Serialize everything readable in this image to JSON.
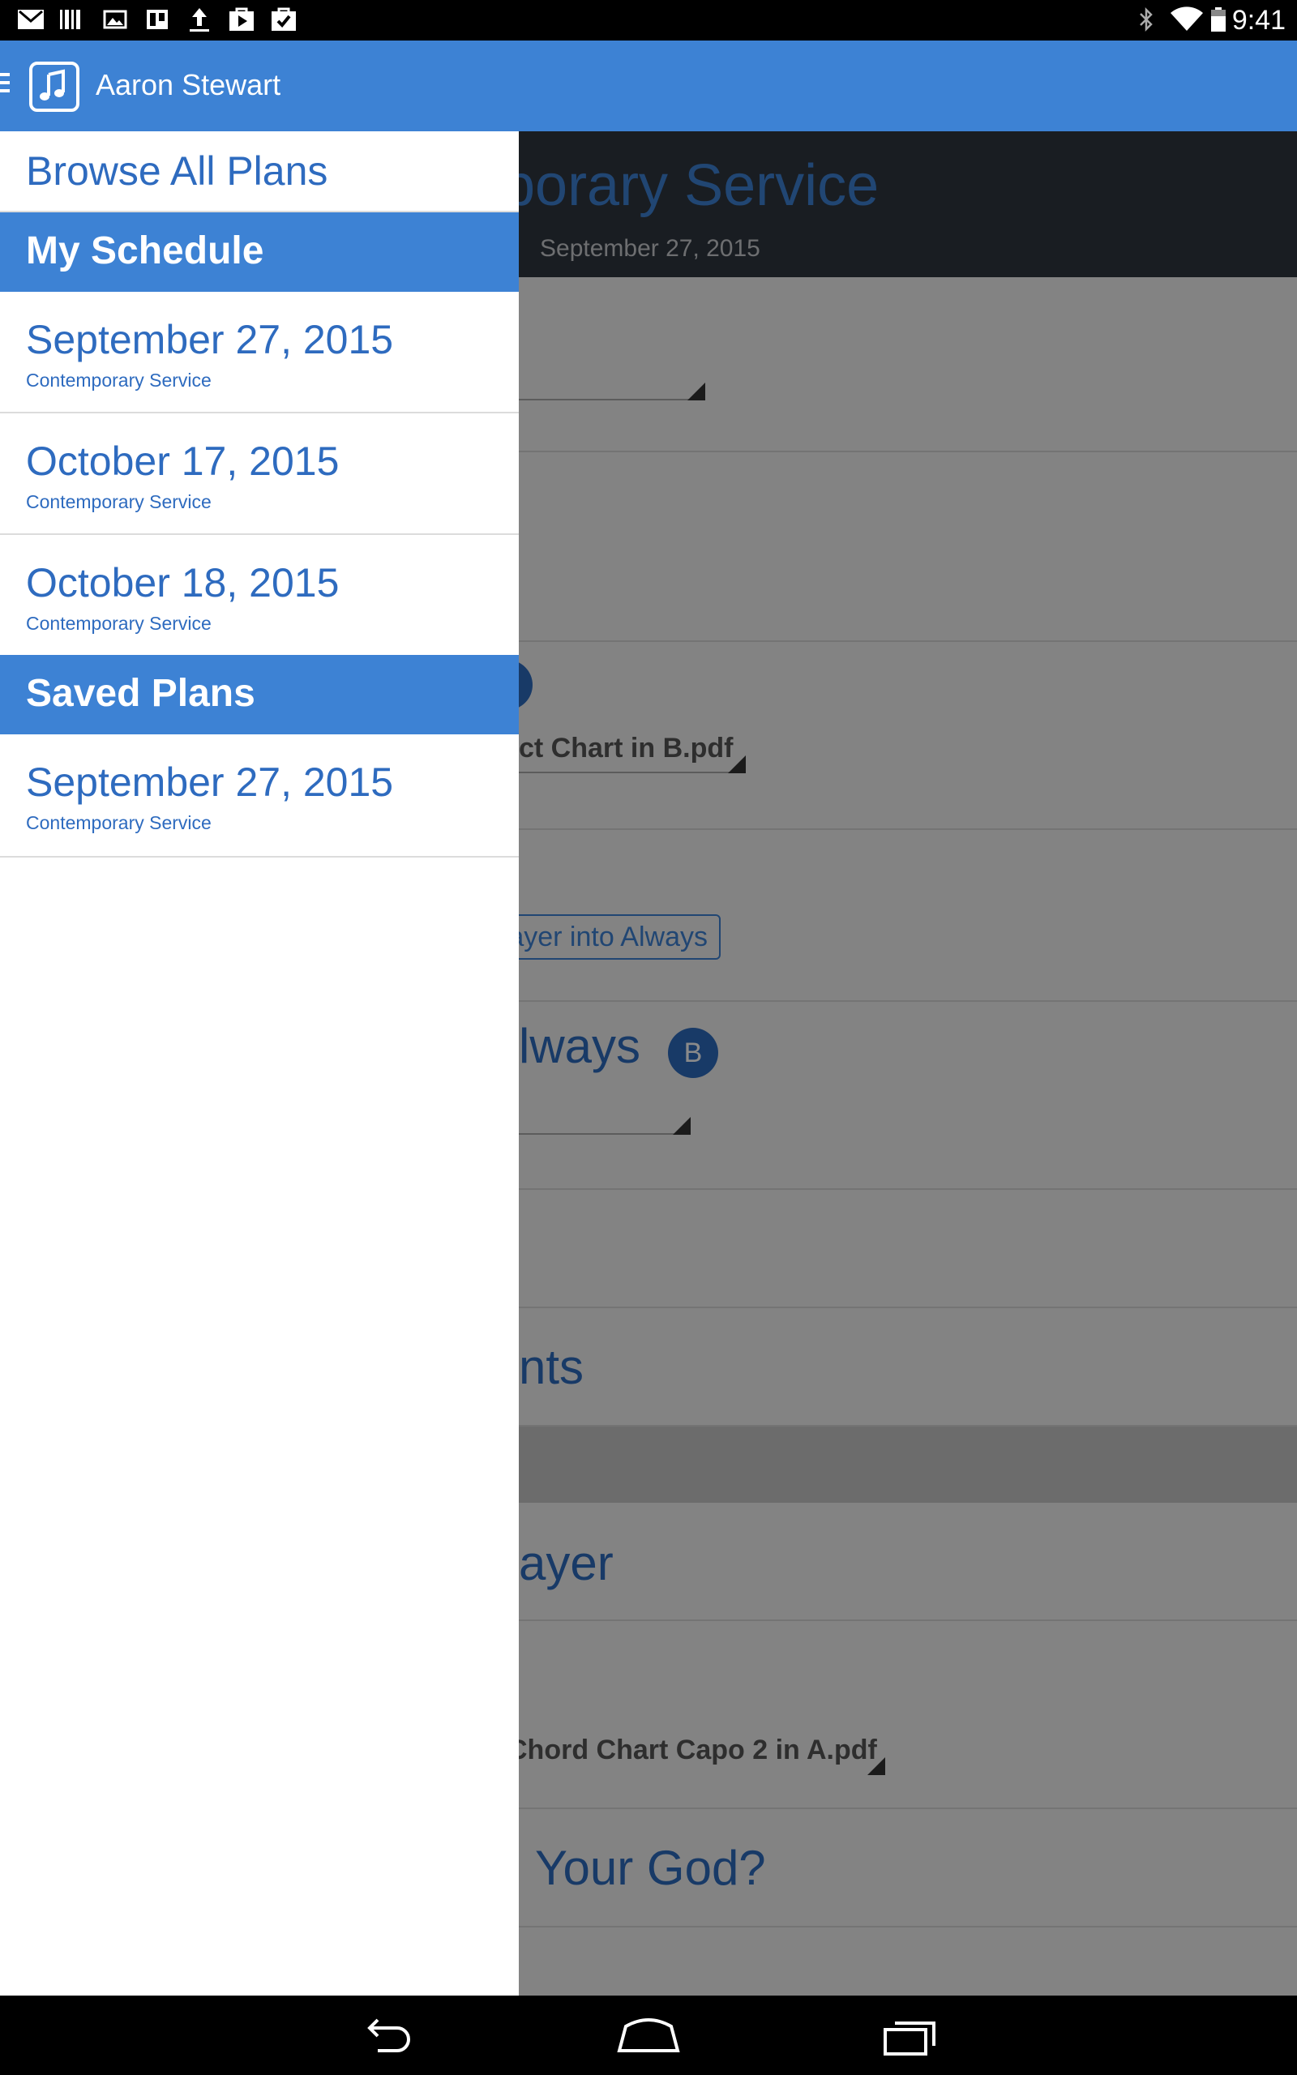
{
  "status_bar": {
    "time": "9:41",
    "left_icons": [
      "gmail-icon",
      "barcode-icon",
      "gallery-icon",
      "trello-icon",
      "upload-icon",
      "play-store-icon",
      "shopping-bag-icon"
    ],
    "right_icons": [
      "bluetooth-icon",
      "wifi-icon",
      "battery-icon"
    ]
  },
  "app_bar": {
    "title": "Aaron Stewart",
    "logo_icon": "music-note-icon",
    "menu_icon": "hamburger-icon",
    "color": "#3d82d4"
  },
  "background_plan": {
    "title": "mporary Service",
    "date": "September 27, 2015",
    "fragments": {
      "chart_b": "ct Chart in B.pdf",
      "prayer_link": "rayer into Always",
      "always": "lways",
      "badge": "B",
      "nts": "nts",
      "ayer": "ayer",
      "chord_capo": "Chord Chart Capo 2 in A.pdf",
      "your_god": "Your God?"
    }
  },
  "drawer": {
    "browse_all": "Browse All Plans",
    "my_schedule": {
      "header": "My Schedule",
      "items": [
        {
          "date": "September 27, 2015",
          "service": "Contemporary Service"
        },
        {
          "date": "October 17, 2015",
          "service": "Contemporary Service"
        },
        {
          "date": "October 18, 2015",
          "service": "Contemporary Service"
        }
      ]
    },
    "saved_plans": {
      "header": "Saved Plans",
      "items": [
        {
          "date": "September 27, 2015",
          "service": "Contemporary Service"
        }
      ]
    }
  },
  "nav_bar": {
    "buttons": [
      "back-icon",
      "home-icon",
      "recent-apps-icon"
    ]
  }
}
